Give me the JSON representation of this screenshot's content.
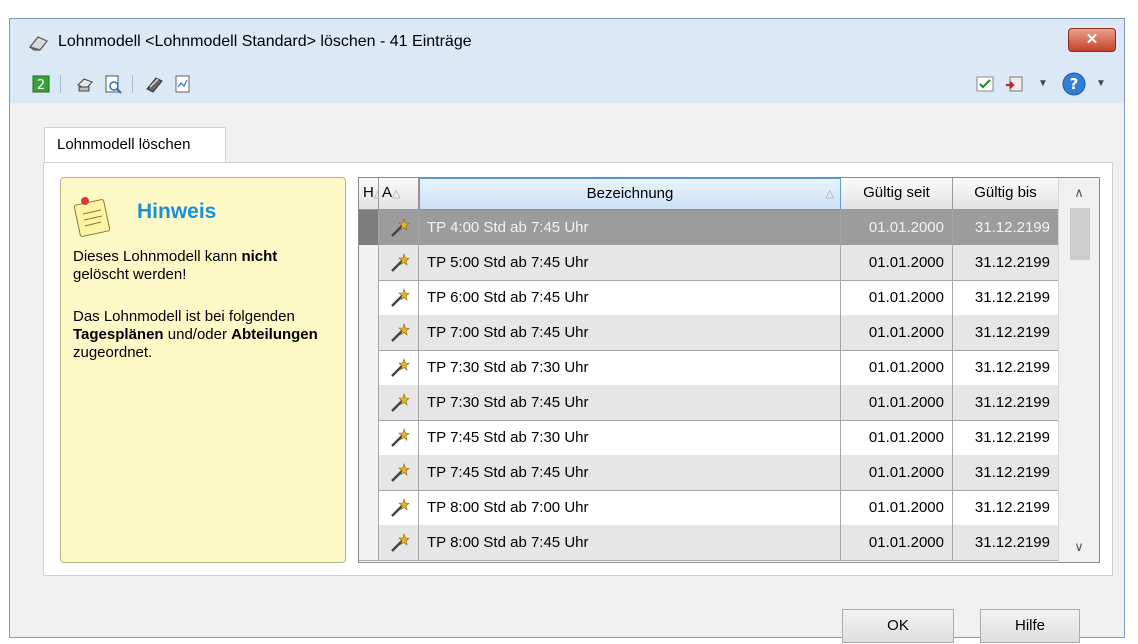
{
  "window": {
    "title": "Lohnmodell <Lohnmodell Standard> löschen - 41 Einträge",
    "close_label": "✕"
  },
  "toolbar": {
    "icons": [
      "refresh-icon",
      "print-icon",
      "print-preview-icon",
      "tools-icon",
      "chart-icon",
      "checkbox-icon",
      "exit-icon",
      "help-icon"
    ]
  },
  "tab": {
    "label": "Lohnmodell löschen"
  },
  "hint": {
    "title": "Hinweis",
    "p1_before": "Dieses Lohnmodell kann ",
    "p1_bold": "nicht",
    "p1_after": " gelöscht werden!",
    "p2_a": "Das Lohnmodell ist bei folgenden ",
    "p2_b": "Tagesplänen",
    "p2_c": " und/oder ",
    "p2_d": "Abteilungen",
    "p2_e": " zugeordnet."
  },
  "table": {
    "headers": {
      "h": "H",
      "a": "A",
      "bez": "Bezeichnung",
      "gs": "Gültig seit",
      "gb": "Gültig bis",
      "sort": "△"
    },
    "rows": [
      {
        "bez": "TP 4:00 Std ab 7:45 Uhr",
        "gs": "01.01.2000",
        "gb": "31.12.2199"
      },
      {
        "bez": "TP 5:00 Std ab 7:45 Uhr",
        "gs": "01.01.2000",
        "gb": "31.12.2199"
      },
      {
        "bez": "TP 6:00 Std ab 7:45 Uhr",
        "gs": "01.01.2000",
        "gb": "31.12.2199"
      },
      {
        "bez": "TP 7:00 Std ab 7:45 Uhr",
        "gs": "01.01.2000",
        "gb": "31.12.2199"
      },
      {
        "bez": "TP 7:30 Std ab 7:30 Uhr",
        "gs": "01.01.2000",
        "gb": "31.12.2199"
      },
      {
        "bez": "TP 7:30 Std ab 7:45 Uhr",
        "gs": "01.01.2000",
        "gb": "31.12.2199"
      },
      {
        "bez": "TP 7:45 Std ab 7:30 Uhr",
        "gs": "01.01.2000",
        "gb": "31.12.2199"
      },
      {
        "bez": "TP 7:45 Std ab 7:45 Uhr",
        "gs": "01.01.2000",
        "gb": "31.12.2199"
      },
      {
        "bez": "TP 8:00 Std ab 7:00 Uhr",
        "gs": "01.01.2000",
        "gb": "31.12.2199"
      },
      {
        "bez": "TP 8:00 Std ab 7:45 Uhr",
        "gs": "01.01.2000",
        "gb": "31.12.2199"
      }
    ]
  },
  "buttons": {
    "ok": "OK",
    "hilfe": "Hilfe"
  }
}
